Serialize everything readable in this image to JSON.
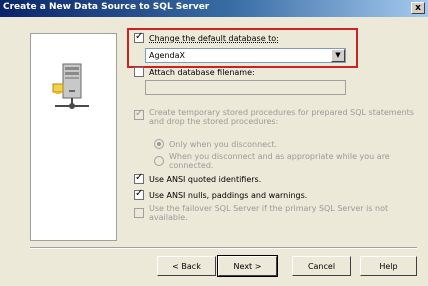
{
  "window": {
    "title": "Create a New Data Source to SQL Server",
    "close_label": "x"
  },
  "options": {
    "change_default_db": {
      "label": "Change the default database to:",
      "checked": true
    },
    "database_combo": {
      "value": "AgendaX"
    },
    "attach_db": {
      "label": "Attach database filename:",
      "checked": false,
      "value": ""
    },
    "create_temp_procs": {
      "line1": "Create temporary stored procedures for prepared SQL statements",
      "line2": "and drop the stored procedures:",
      "checked": true,
      "disabled": true
    },
    "radio_only_disconnect": {
      "label": "Only when you disconnect.",
      "selected": true
    },
    "radio_disconnect_appropriate": {
      "line1": "When you disconnect and as appropriate while you are",
      "line2": "connected."
    },
    "quoted_identifiers": {
      "label": "Use ANSI quoted identifiers.",
      "checked": true
    },
    "ansi_nulls": {
      "label": "Use ANSI nulls, paddings and warnings.",
      "checked": true
    },
    "failover": {
      "line1": "Use the failover SQL Server if the primary SQL Server is not",
      "line2": "available.",
      "checked": false,
      "disabled": true
    }
  },
  "buttons": {
    "back": "< Back",
    "next": "Next >",
    "cancel": "Cancel",
    "help": "Help"
  },
  "colors": {
    "titlebar_start": "#0a246a",
    "titlebar_end": "#a6caf0",
    "highlight": "#cc2222",
    "dialog_bg": "#ece9d8"
  },
  "icons": {
    "server": "server-icon",
    "close": "close-icon",
    "dropdown": "chevron-down-icon"
  }
}
